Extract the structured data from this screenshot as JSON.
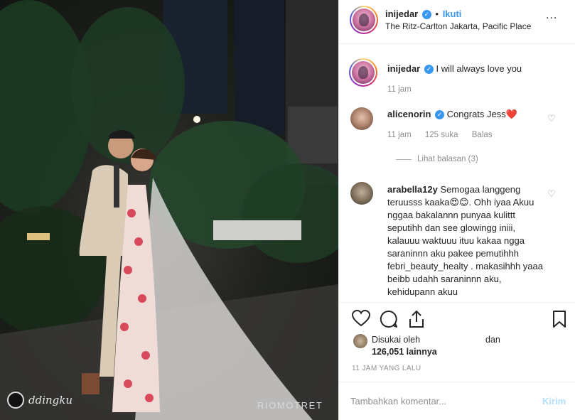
{
  "photo": {
    "watermark_left": "ddingku",
    "watermark_right": "RIOMOTRET"
  },
  "header": {
    "username": "inijedar",
    "separator": "•",
    "follow_label": "Ikuti",
    "location": "The Ritz-Carlton Jakarta, Pacific Place",
    "more_label": "..."
  },
  "caption": {
    "username": "inijedar",
    "text": "I will always love you",
    "time": "11 jam"
  },
  "comments": [
    {
      "username": "alicenorin",
      "text": "Congrats Jess❤️",
      "time": "11 jam",
      "likes": "125 suka",
      "reply": "Balas",
      "view_replies": "Lihat balasan (3)"
    },
    {
      "username": "arabella12y",
      "text": "Semogaa langgeng teruusss kaaka😍😊. Ohh iyaa Akuu nggaa bakalannn punyaa kulittt seputihh dan see glowingg iniii, kalauuu waktuuu ituu kakaa ngga saraninnn aku pakee pemutihhh febri_beauty_healty . makasihhh yaaa beibb udahh saraninnn aku, kehidupann akuu"
    }
  ],
  "likes": {
    "prefix": "Disukai oleh",
    "conjunction": "dan",
    "count": "126,051 lainnya"
  },
  "timestamp": "11 JAM YANG LALU",
  "add_comment": {
    "placeholder": "Tambahkan komentar...",
    "post_label": "Kirim"
  },
  "icons": {
    "like": "heart-icon",
    "comment": "comment-icon",
    "share": "share-icon",
    "save": "bookmark-icon"
  },
  "colors": {
    "link_blue": "#3897f0",
    "post_disabled": "#b2dffc",
    "muted_text": "#8e8e8e"
  }
}
